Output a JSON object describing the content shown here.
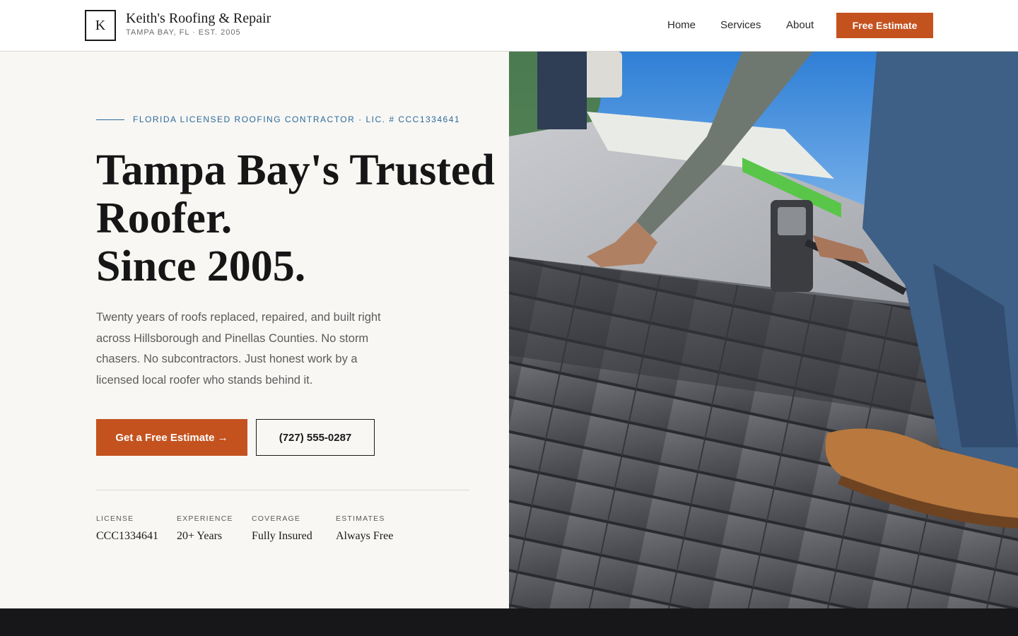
{
  "header": {
    "logo_letter": "K",
    "brand_name": "Keith's Roofing & Repair",
    "brand_tagline": "TAMPA BAY, FL · EST. 2005",
    "nav": {
      "home": "Home",
      "services": "Services",
      "about": "About"
    },
    "cta_label": "Free Estimate"
  },
  "hero": {
    "eyebrow": "FLORIDA LICENSED ROOFING CONTRACTOR · LIC. # CCC1334641",
    "headline_line1": "Tampa Bay's Trusted",
    "headline_line2": "Roofer.",
    "headline_line3": "Since 2005.",
    "lede": "Twenty years of roofs replaced, repaired, and built right across Hillsborough and Pinellas Counties. No storm chasers. No subcontractors. Just honest work by a licensed local roofer who stands behind it.",
    "primary_button": "Get a Free Estimate →",
    "phone_button": "(727) 555-0287",
    "stats": [
      {
        "label": "LICENSE",
        "value": "CCC1334641"
      },
      {
        "label": "EXPERIENCE",
        "value": "20+ Years"
      },
      {
        "label": "COVERAGE",
        "value": "Fully Insured"
      },
      {
        "label": "ESTIMATES",
        "value": "Always Free"
      }
    ],
    "photo_subject": "roofer-nailing-shingles-photo"
  },
  "colors": {
    "accent": "#c4521f",
    "eyebrow_blue": "#2c6a9a",
    "hero_bg": "#f8f7f4",
    "dark_band": "#17171a"
  }
}
